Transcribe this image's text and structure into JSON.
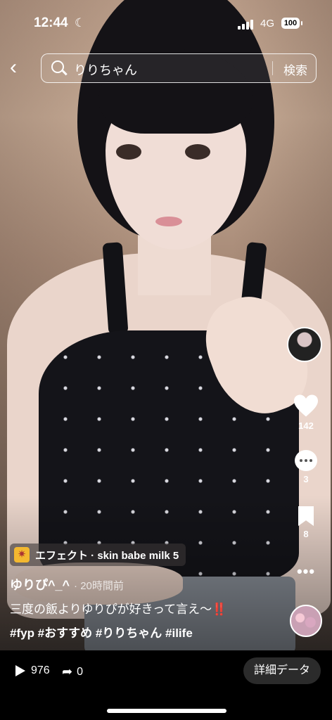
{
  "status": {
    "time": "12:44",
    "network": "4G",
    "battery": "100"
  },
  "search": {
    "query": "りりちゃん",
    "button": "検索"
  },
  "rail": {
    "likes": "142",
    "comments": "3",
    "bookmarks": "8"
  },
  "post": {
    "effect_label": "エフェクト · skin babe milk 5",
    "author": "ゆりぴ^_^",
    "time_ago": "· 20時間前",
    "caption": "三度の飯よりゆりぴが好きって言え〜",
    "caption_emoji": "‼️",
    "hashtags": "#fyp #おすすめ #りりちゃん #ilife"
  },
  "bottom": {
    "plays": "976",
    "shares": "0",
    "detail_button": "詳細データ"
  },
  "colors": {
    "accent_red": "#ff3b30",
    "effect_icon": "#f3b830"
  }
}
